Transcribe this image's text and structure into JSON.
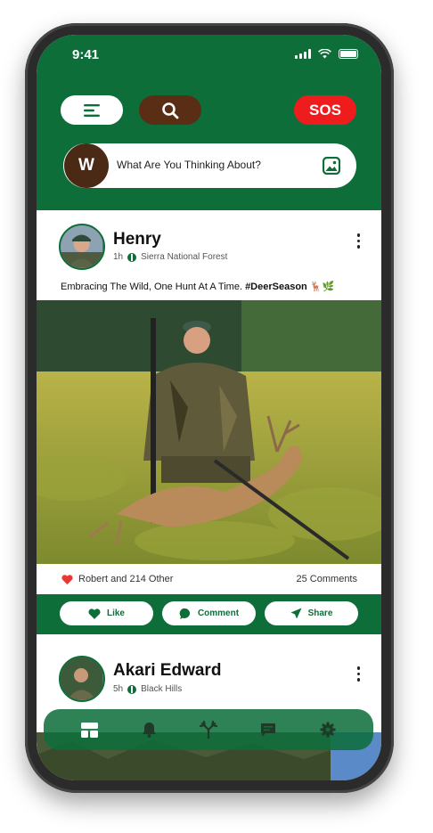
{
  "status_bar": {
    "time": "9:41"
  },
  "header": {
    "sos_label": "SOS",
    "composer": {
      "avatar_letter": "W",
      "placeholder": "What Are You Thinking About?"
    }
  },
  "posts": [
    {
      "author": "Henry",
      "time_ago": "1h",
      "location": "Sierra National Forest",
      "caption_text": "Embracing The Wild, One Hunt At A Time.",
      "caption_hashtag": "#DeerSeason",
      "caption_emoji": "🦌🌿",
      "liked_by": "Robert and 214 Other",
      "comments": "25 Comments"
    },
    {
      "author": "Akari Edward",
      "time_ago": "5h",
      "location": "Black Hills"
    }
  ],
  "actions": {
    "like": "Like",
    "comment": "Comment",
    "share": "Share"
  },
  "tabbar": {
    "items": [
      "dashboard-icon",
      "bell-icon",
      "antler-icon",
      "message-icon",
      "gear-icon"
    ]
  },
  "colors": {
    "brand_green": "#0d6e3a",
    "sos_red": "#ee1c1c",
    "brown": "#5a2e14",
    "like_red": "#e53935"
  }
}
